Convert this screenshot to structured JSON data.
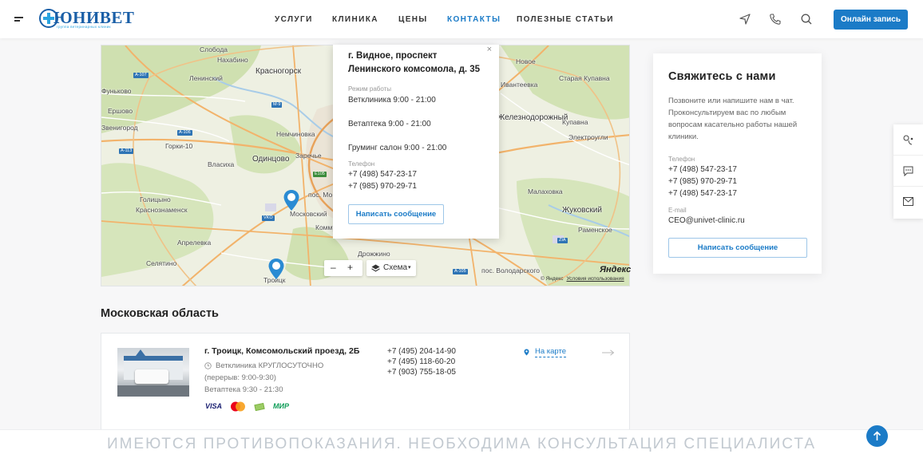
{
  "header": {
    "logo_text": "ЮНИВЕТ",
    "logo_sub": "группа ветеринарных клиник",
    "nav": [
      {
        "label": "УСЛУГИ",
        "active": false
      },
      {
        "label": "КЛИНИКА",
        "active": false
      },
      {
        "label": "ЦЕНЫ",
        "active": false
      },
      {
        "label": "КОНТАКТЫ",
        "active": true
      },
      {
        "label": "ПОЛЕЗНЫЕ СТАТЬИ",
        "active": false
      }
    ],
    "icons": [
      "location-arrow-icon",
      "phone-icon",
      "search-icon"
    ],
    "cta_label": "Онлайн запись",
    "accent": "#1b7bc7"
  },
  "map": {
    "labels": [
      "Нахабино",
      "Красногорск",
      "Ленинский",
      "Слобода",
      "Фуньково",
      "Ершово",
      "Звенигород",
      "Горки-10",
      "Власиха",
      "Одинцово",
      "Немчиновка",
      "Заречье",
      "Голицыно",
      "Краснознаменск",
      "Апрелевка",
      "Селятино",
      "Московский",
      "Троицк",
      "Коммунарка",
      "Дрожжино",
      "Ивантеевка",
      "Новое",
      "Старая Купавна",
      "Железнодорожный",
      "Купавна",
      "Электроугли",
      "Малаховка",
      "Жуковский",
      "Раменское",
      "пос. Володарского",
      "пос. Мо"
    ],
    "road_badges": [
      "А-107",
      "А-106",
      "А-113",
      "М-9",
      "МКАД",
      "Е105",
      "ЦКАД",
      "VKO",
      "ZIA",
      "А-105"
    ],
    "popup": {
      "title": "г. Видное, проспект Ленинского комсомола, д. 35",
      "hours_label": "Режим работы",
      "hours": [
        "Ветклиника 9:00 - 21:00",
        "Ветаптека 9:00 - 21:00",
        "Груминг салон 9:00 - 21:00"
      ],
      "phone_label": "Телефон",
      "phones": [
        "+7 (498) 547-23-17",
        "+7 (985) 970-29-71"
      ],
      "button": "Написать сообщение",
      "close": "×"
    },
    "zoom_minus": "–",
    "zoom_plus": "+",
    "layers_label": "Схема",
    "brand": "Яндекс",
    "copyright": "© Яндекс",
    "terms": "Условия использования"
  },
  "contact": {
    "title": "Свяжитесь с нами",
    "description": "Позвоните или напишите нам в чат. Проконсультируем вас по любым вопросам касательно работы нашей клиники.",
    "phone_label": "Телефон",
    "phones": [
      "+7 (498) 547-23-17",
      "+7 (985) 970-29-71",
      "+7 (498) 547-23-17"
    ],
    "email_label": "E-mail",
    "email": "CEO@univet-clinic.ru",
    "button": "Написать сообщение"
  },
  "side_tools": [
    "vet-consult-icon",
    "chat-icon",
    "mail-icon"
  ],
  "region": {
    "title": "Московская область",
    "clinics": [
      {
        "address": "г. Троицк, Комсомольский проезд, 2Б",
        "vet_line": "Ветклиника КРУГЛОСУТОЧНО",
        "break_line": "(перерыв: 9:00-9:30)",
        "pharmacy_line": "Ветаптека 9:30 - 21:30",
        "payments": [
          "VISA",
          "mastercard",
          "cash",
          "МИР"
        ],
        "phones": [
          "+7 (495) 204-14-90",
          "+7 (495) 118-60-20",
          "+7 (903) 755-18-05"
        ],
        "map_link": "На карте"
      }
    ]
  },
  "disclaimer": "ИМЕЮТСЯ ПРОТИВОПОКАЗАНИЯ. НЕОБХОДИМА КОНСУЛЬТАЦИЯ СПЕЦИАЛИСТА"
}
